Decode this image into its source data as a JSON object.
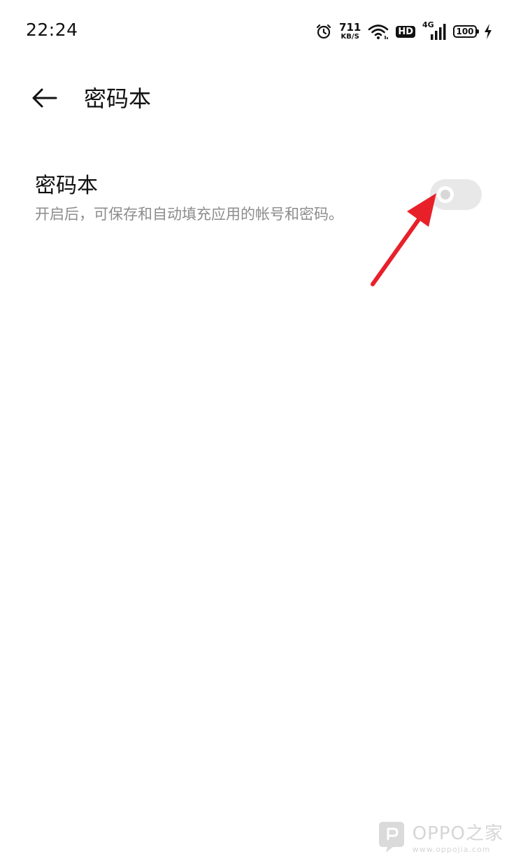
{
  "status_bar": {
    "time": "22:24",
    "net_speed_value": "711",
    "net_speed_unit": "KB/S",
    "hd_label": "HD",
    "network_type": "4G",
    "battery_level": "100",
    "icons": [
      "alarm-icon",
      "wifi-icon",
      "hd-icon",
      "signal-icon",
      "battery-icon",
      "charging-icon"
    ]
  },
  "header": {
    "back_icon": "arrow-left-icon",
    "title": "密码本"
  },
  "setting": {
    "title": "密码本",
    "description": "开启后，可保存和自动填充应用的帐号和密码。",
    "toggle_state": "off"
  },
  "annotation": {
    "color": "#e8202a"
  },
  "watermark": {
    "brand": "OPPO之家",
    "url": "www.oppojia.com"
  },
  "colors": {
    "background": "#ffffff",
    "text_primary": "#111111",
    "text_secondary": "#8c8c8c",
    "toggle_off": "#e8e8e8"
  }
}
